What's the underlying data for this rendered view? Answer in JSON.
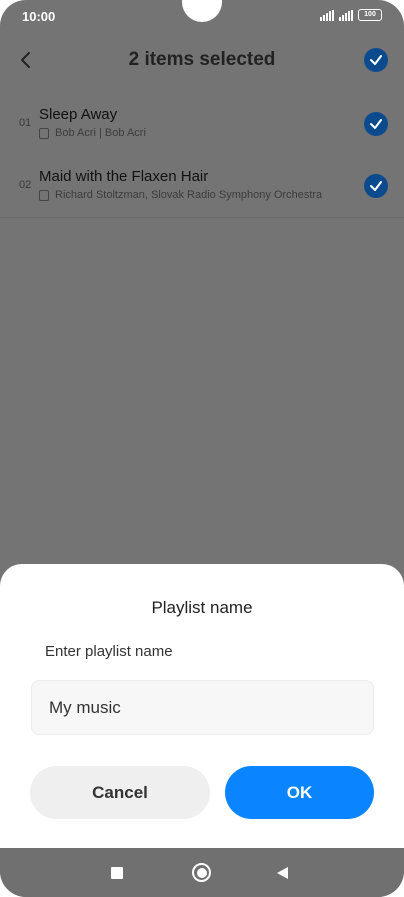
{
  "status_bar": {
    "time": "10:00",
    "battery": "100",
    "icons": [
      "signal-icon",
      "signal-icon",
      "battery-icon"
    ]
  },
  "header": {
    "title": "2 items selected",
    "back_icon": "chevron-left-icon",
    "select_all_icon": "check-circle-icon"
  },
  "list": {
    "items": [
      {
        "number": "01",
        "title": "Sleep Away",
        "subtitle": "Bob Acri | Bob Acri",
        "selected": true
      },
      {
        "number": "02",
        "title": "Maid with the Flaxen Hair",
        "subtitle": "Richard Stoltzman, Slovak Radio Symphony Orchestra",
        "selected": true
      }
    ]
  },
  "dialog": {
    "title": "Playlist name",
    "label": "Enter playlist name",
    "input_value": "My music",
    "cancel_label": "Cancel",
    "ok_label": "OK"
  },
  "nav_bar": {
    "icons": [
      "recents-square-icon",
      "home-circle-icon",
      "back-triangle-icon"
    ]
  },
  "colors": {
    "accent": "#0a84ff",
    "check": "#0b4a8c",
    "scrim": "#747474"
  }
}
